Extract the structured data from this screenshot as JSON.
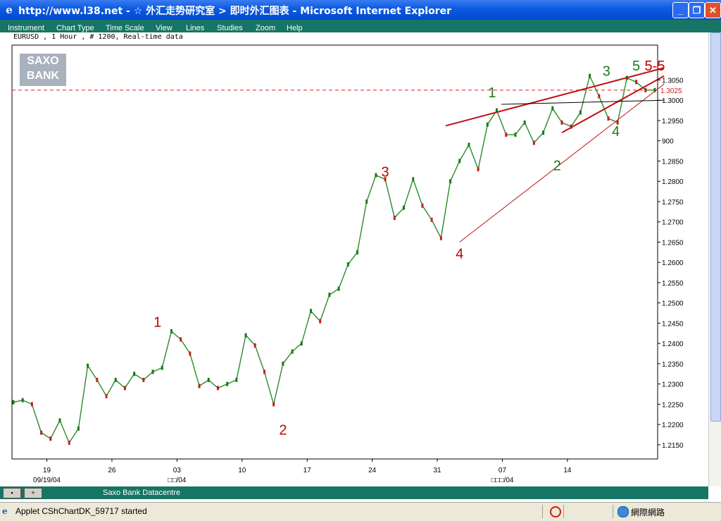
{
  "window": {
    "title": "http://www.l38.net - ☆ 外汇走势研究室 > 即时外汇图表 - Microsoft Internet Explorer",
    "minimize_symbol": "_",
    "maximize_symbol": "❐",
    "close_symbol": "✕"
  },
  "menu": {
    "items": [
      "Instrument",
      "Chart Type",
      "Time Scale",
      "View",
      "Lines",
      "Studies",
      "Zoom",
      "Help"
    ]
  },
  "chart_header": "EURUSD , 1 Hour , # 1200, Real-time data",
  "logo": {
    "line1": "SAXO",
    "line2": "BANK"
  },
  "chart_data": {
    "type": "line",
    "instrument": "EURUSD",
    "y_ticks": [
      "1.3050",
      "1.3000",
      "1.2950",
      "900",
      "1.2850",
      "1.2800",
      "1.2750",
      "1.2700",
      "1.2650",
      "1.2600",
      "1.2550",
      "1.2500",
      "1.2450",
      "1.2400",
      "1.2350",
      "1.2300",
      "1.2250",
      "1.2200",
      "1.2150"
    ],
    "y_tick_values": [
      1.305,
      1.3,
      1.295,
      1.29,
      1.285,
      1.28,
      1.275,
      1.27,
      1.265,
      1.26,
      1.255,
      1.25,
      1.245,
      1.24,
      1.235,
      1.23,
      1.225,
      1.22,
      1.215
    ],
    "ylim": [
      1.2115,
      1.3136
    ],
    "x_ticks": [
      "19",
      "26",
      "03",
      "10",
      "17",
      "24",
      "31",
      "07",
      "14"
    ],
    "x_tick_index": [
      3.6,
      10.6,
      17.6,
      24.6,
      31.6,
      38.6,
      45.6,
      52.6,
      59.6
    ],
    "x_group_labels": [
      "09/19/04",
      "□□/04",
      "□□□/04"
    ],
    "x_group_index": [
      3.6,
      17.6,
      52.6
    ],
    "price_marker": "1.3025",
    "price_marker_value": 1.3025,
    "series": [
      {
        "x": [
          0,
          1,
          2,
          3,
          4,
          5,
          6,
          7,
          8,
          9,
          10,
          11,
          12,
          13,
          14,
          15,
          16,
          17,
          18,
          19,
          20,
          21,
          22,
          23,
          24,
          25,
          26,
          27,
          28,
          29,
          30,
          31,
          32,
          33,
          34,
          35,
          36,
          37,
          38,
          39,
          40,
          41,
          42,
          43,
          44,
          45,
          46,
          47,
          48,
          49,
          50,
          51,
          52,
          53,
          54,
          55,
          56,
          57,
          58,
          59,
          60,
          61,
          62,
          63,
          64,
          65,
          66,
          67,
          68,
          69
        ],
        "values": [
          1.2255,
          1.226,
          1.225,
          1.218,
          1.2165,
          1.221,
          1.2155,
          1.219,
          1.2345,
          1.231,
          1.227,
          1.231,
          1.229,
          1.2325,
          1.231,
          1.233,
          1.234,
          1.243,
          1.241,
          1.2375,
          1.2295,
          1.231,
          1.229,
          1.23,
          1.231,
          1.242,
          1.2395,
          1.233,
          1.225,
          1.235,
          1.238,
          1.24,
          1.248,
          1.2455,
          1.252,
          1.2535,
          1.2595,
          1.2625,
          1.275,
          1.2815,
          1.2805,
          1.271,
          1.2735,
          1.2805,
          1.274,
          1.2705,
          1.266,
          1.28,
          1.285,
          1.289,
          1.283,
          1.294,
          1.2975,
          1.2915,
          1.2915,
          1.2945,
          1.2895,
          1.292,
          1.298,
          1.2945,
          1.2935,
          1.297,
          1.306,
          1.301,
          1.2955,
          1.2945,
          1.3055,
          1.3045,
          1.3025,
          1.3025
        ]
      }
    ],
    "wave_labels": [
      {
        "text": "1",
        "color": "#c00000",
        "x": 15.5,
        "y": 1.2441
      },
      {
        "text": "2",
        "color": "#c00000",
        "x": 29.0,
        "y": 1.2175
      },
      {
        "text": "3",
        "color": "#c00000",
        "x": 40.0,
        "y": 1.2812
      },
      {
        "text": "4",
        "color": "#c00000",
        "x": 48.0,
        "y": 1.261
      },
      {
        "text": "1",
        "color": "#1a7a1a",
        "x": 51.5,
        "y": 1.3007
      },
      {
        "text": "2",
        "color": "#1a7a1a",
        "x": 58.5,
        "y": 1.2827
      },
      {
        "text": "3",
        "color": "#1a7a1a",
        "x": 63.8,
        "y": 1.306
      },
      {
        "text": "4",
        "color": "#1a7a1a",
        "x": 64.8,
        "y": 1.2912
      },
      {
        "text": "5",
        "color": "#1a7a1a",
        "x": 67.0,
        "y": 1.3073
      },
      {
        "text": "5-5",
        "color": "#c00000",
        "x": 69.0,
        "y": 1.3073
      }
    ],
    "trend_lines": [
      {
        "from": [
          46.5,
          1.2937
        ],
        "to": [
          70.0,
          1.308
        ],
        "color": "#c01010",
        "width": 2
      },
      {
        "from": [
          48.0,
          1.265
        ],
        "to": [
          70.0,
          1.304
        ],
        "color": "#c01010",
        "width": 1
      },
      {
        "from": [
          59.0,
          1.292
        ],
        "to": [
          70.0,
          1.306
        ],
        "color": "#c01010",
        "width": 2
      },
      {
        "from": [
          52.5,
          1.299
        ],
        "to": [
          70.0,
          1.3
        ],
        "color": "#000000",
        "width": 1
      }
    ]
  },
  "bottom_bar": {
    "left_btn": "▪",
    "right_btn": "+",
    "label": "Saxo Bank Datacentre"
  },
  "status": {
    "text": "Applet CShChartDK_59717 started",
    "zone": "網際網路"
  }
}
